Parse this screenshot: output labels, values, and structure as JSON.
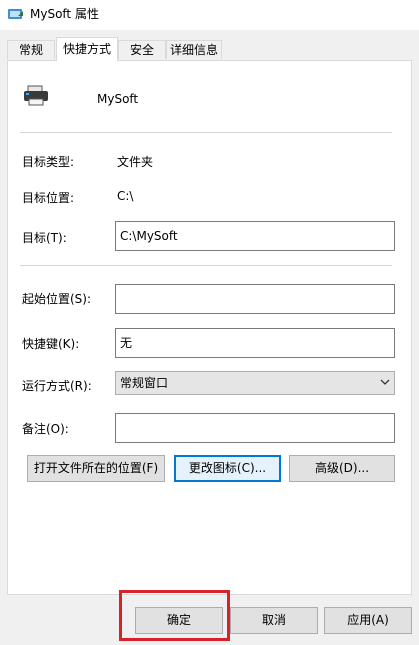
{
  "window": {
    "title": "MySoft 属性"
  },
  "tabs": [
    {
      "label": "常规"
    },
    {
      "label": "快捷方式"
    },
    {
      "label": "安全"
    },
    {
      "label": "详细信息"
    }
  ],
  "active_tab": "快捷方式",
  "header": {
    "app_name": "MySoft"
  },
  "fields": {
    "target_type": {
      "label": "目标类型:",
      "value": "文件夹"
    },
    "target_location": {
      "label": "目标位置:",
      "value": "C:\\"
    },
    "target": {
      "label": "目标(T):",
      "value": "C:\\MySoft"
    },
    "start_in": {
      "label": "起始位置(S):",
      "value": ""
    },
    "shortcut_key": {
      "label": "快捷键(K):",
      "value": "无"
    },
    "run": {
      "label": "运行方式(R):",
      "value": "常规窗口"
    },
    "comment": {
      "label": "备注(O):",
      "value": ""
    }
  },
  "buttons": {
    "open_location": "打开文件所在的位置(F)",
    "change_icon": "更改图标(C)...",
    "advanced": "高级(D)..."
  },
  "dialog_buttons": {
    "ok": "确定",
    "cancel": "取消",
    "apply": "应用(A)"
  },
  "colors": {
    "highlight_border": "#d6232a",
    "focus_border": "#0078d7"
  }
}
